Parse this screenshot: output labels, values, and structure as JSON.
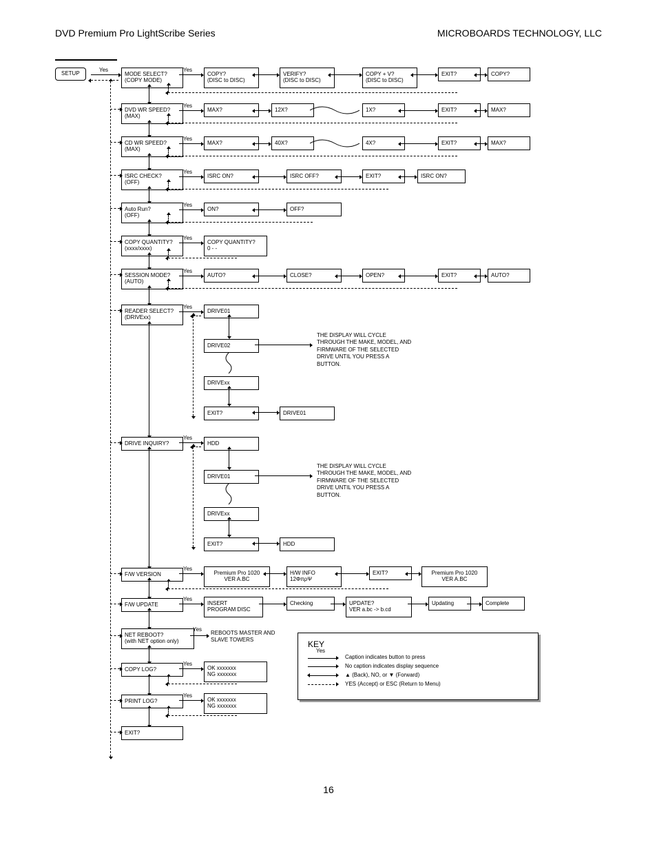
{
  "header": {
    "left": "DVD Premium Pro LightScribe Series",
    "right": "MICROBOARDS TECHNOLOGY, LLC"
  },
  "page_number": "16",
  "yes": "Yes",
  "setup": "SETUP",
  "rows": {
    "mode": {
      "menu": "MODE SELECT?",
      "sub": "(COPY MODE)",
      "o1": "COPY?",
      "o1s": "(DISC to DISC)",
      "o2": "VERIFY?",
      "o2s": "(DISC to DISC)",
      "o3": "COPY + V?",
      "o3s": "(DISC to DISC)",
      "exit": "EXIT?",
      "wrap": "COPY?"
    },
    "dvd": {
      "menu": "DVD WR SPEED?",
      "sub": "(MAX)",
      "o1": "MAX?",
      "o2": "12X?",
      "o3": "1X?",
      "exit": "EXIT?",
      "wrap": "MAX?"
    },
    "cd": {
      "menu": "CD WR SPEED?",
      "sub": "(MAX)",
      "o1": "MAX?",
      "o2": "40X?",
      "o3": "4X?",
      "exit": "EXIT?",
      "wrap": "MAX?"
    },
    "isrc": {
      "menu": "ISRC CHECK?",
      "sub": "(OFF)",
      "o1": "ISRC ON?",
      "o2": "ISRC OFF?",
      "exit": "EXIT?",
      "wrap": "ISRC ON?"
    },
    "auto": {
      "menu": "Auto Run?",
      "sub": "(OFF)",
      "o1": "ON?",
      "o2": "OFF?"
    },
    "qty": {
      "menu": "COPY QUANTITY?",
      "sub": "(xxxx/xxxx)",
      "o1": "COPY QUANTITY?",
      "o1s": "0 - -"
    },
    "sess": {
      "menu": "SESSION MODE?",
      "sub": "(AUTO)",
      "o1": "AUTO?",
      "o2": "CLOSE?",
      "o3": "OPEN?",
      "exit": "EXIT?",
      "wrap": "AUTO?"
    },
    "reader": {
      "menu": "READER SELECT?",
      "sub": "(DRIVExx)",
      "d1": "DRIVE01",
      "d2": "DRIVE02",
      "dx": "DRIVExx",
      "exit": "EXIT?",
      "wrap": "DRIVE01"
    },
    "inq": {
      "menu": "DRIVE INQUIRY?",
      "d1": "HDD",
      "d2": "DRIVE01",
      "dx": "DRIVExx",
      "exit": "EXIT?",
      "wrap": "HDD"
    },
    "fwv": {
      "menu": "F/W VERSION",
      "o1": "Premium Pro 1020",
      "o1s": "VER A.BC",
      "o2": "H/W INFO",
      "o2s": "12ΦπρΨ",
      "exit": "EXIT?",
      "wrap": "Premium Pro 1020",
      "wraps": "VER A.BC"
    },
    "fwu": {
      "menu": "F/W UPDATE",
      "o1": "INSERT",
      "o1s": "PROGRAM DISC",
      "o2": "Checking",
      "o3": "UPDATE?",
      "o3s": "VER a.bc -> b.cd",
      "o4": "Updating",
      "o5": "Complete"
    },
    "net": {
      "menu": "NET REBOOT?",
      "sub": "(with NET option only)",
      "txt": "REBOOTS MASTER AND SLAVE TOWERS"
    },
    "clog": {
      "menu": "COPY LOG?",
      "l1": "OK    xxxxxxx",
      "l2": "NG    xxxxxxx"
    },
    "plog": {
      "menu": "PRINT LOG?",
      "l1": "OK    xxxxxxx",
      "l2": "NG    xxxxxxx"
    },
    "exit": {
      "menu": "EXIT?"
    }
  },
  "note_cycle": "THE DISPLAY WILL CYCLE THROUGH THE MAKE, MODEL, AND FIRMWARE OF THE SELECTED DRIVE UNTIL YOU PRESS A BUTTON.",
  "key": {
    "title": "KEY",
    "k1": "Caption indicates button to press",
    "k2": "No caption indicates display sequence",
    "k3": "▲ (Back),  NO, or ▼ (Forward)",
    "k4": "YES (Accept) or ESC (Return to Menu)"
  }
}
